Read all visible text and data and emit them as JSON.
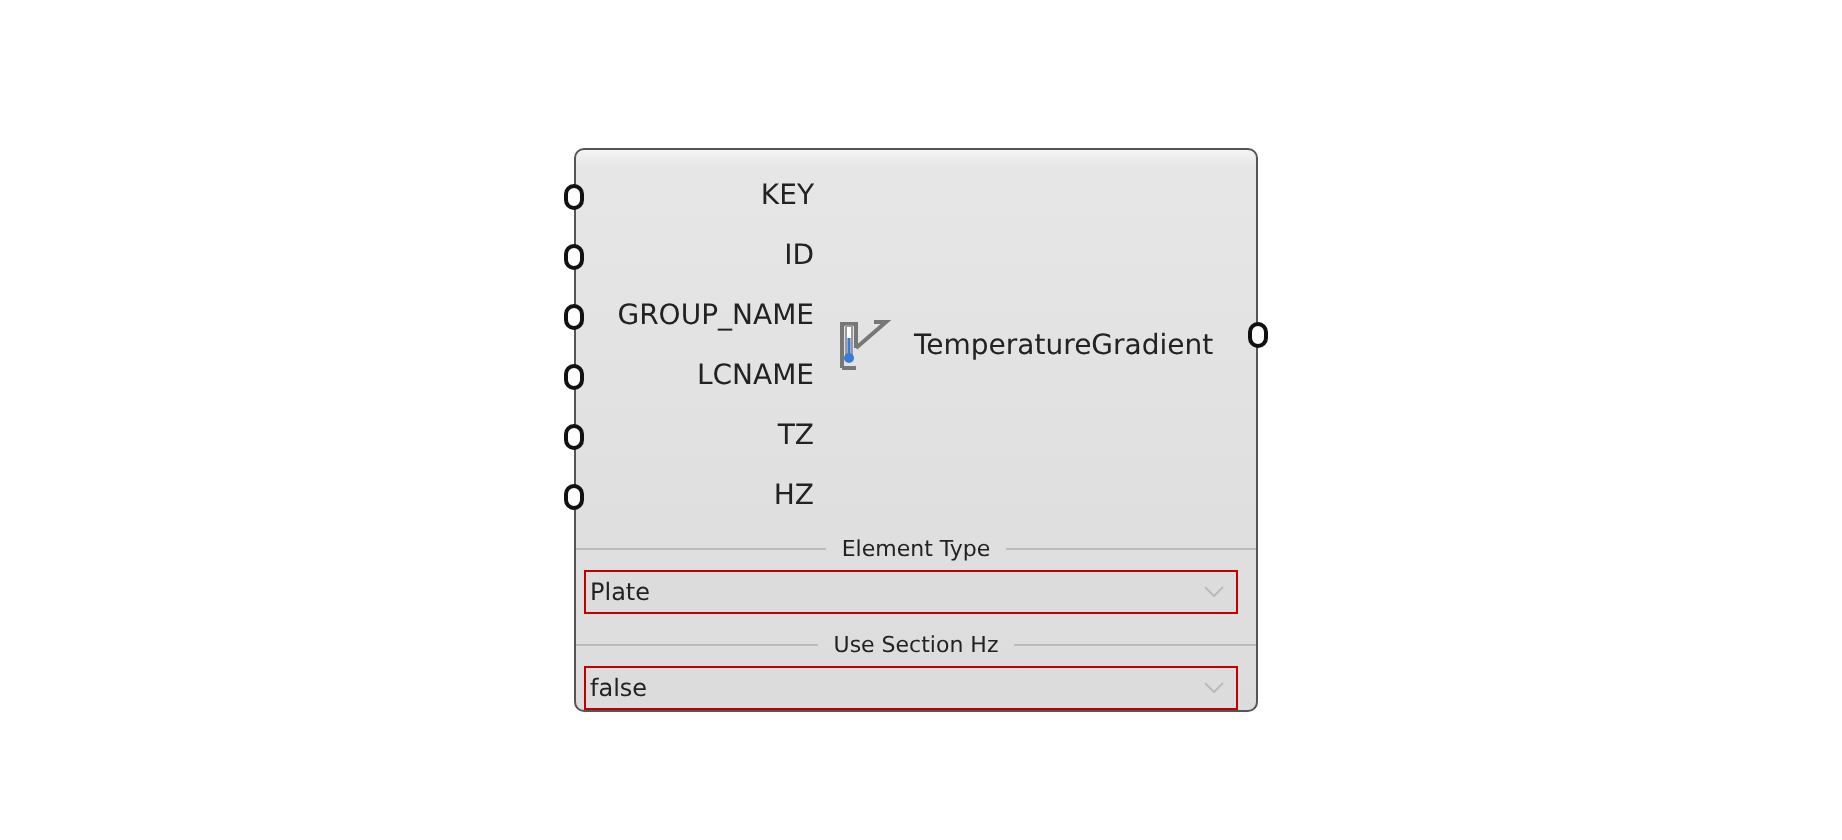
{
  "component": {
    "inputs": [
      "KEY",
      "ID",
      "GROUP_NAME",
      "LCNAME",
      "TZ",
      "HZ"
    ],
    "name": "TemperatureGradient",
    "dropdowns": [
      {
        "title": "Element Type",
        "value": "Plate"
      },
      {
        "title": "Use Section Hz",
        "value": "false"
      }
    ]
  }
}
